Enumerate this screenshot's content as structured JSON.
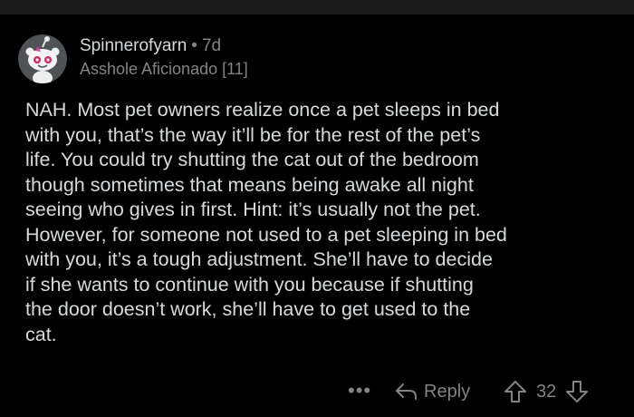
{
  "comment": {
    "username": "Spinnerofyarn",
    "separator": "•",
    "age": "7d",
    "flair": "Asshole Aficionado [11]",
    "avatar_icon": "snoo-avatar-icon",
    "body": "NAH. Most pet owners realize once a pet sleeps in bed\nwith you, that’s the way it’ll be for the rest of the pet’s\nlife. You could try shutting the cat out of the bedroom\nthough sometimes that means being awake all night\nseeing who gives in first. Hint: it’s usually not the pet.\nHowever, for someone not used to a pet sleeping in bed\nwith you, it’s a tough adjustment. She’ll have to decide\nif she wants to continue with you because if shutting\nthe door doesn’t work, she’ll have to get used to the\ncat."
  },
  "actions": {
    "more_label": "•••",
    "reply_label": "Reply",
    "reply_icon": "reply-arrow-icon",
    "upvote_icon": "upvote-arrow-icon",
    "downvote_icon": "downvote-arrow-icon",
    "score": "32"
  },
  "colors": {
    "background": "#000000",
    "text": "#d7dadc",
    "muted": "#818384",
    "avatar_bg": "#4f5356"
  }
}
